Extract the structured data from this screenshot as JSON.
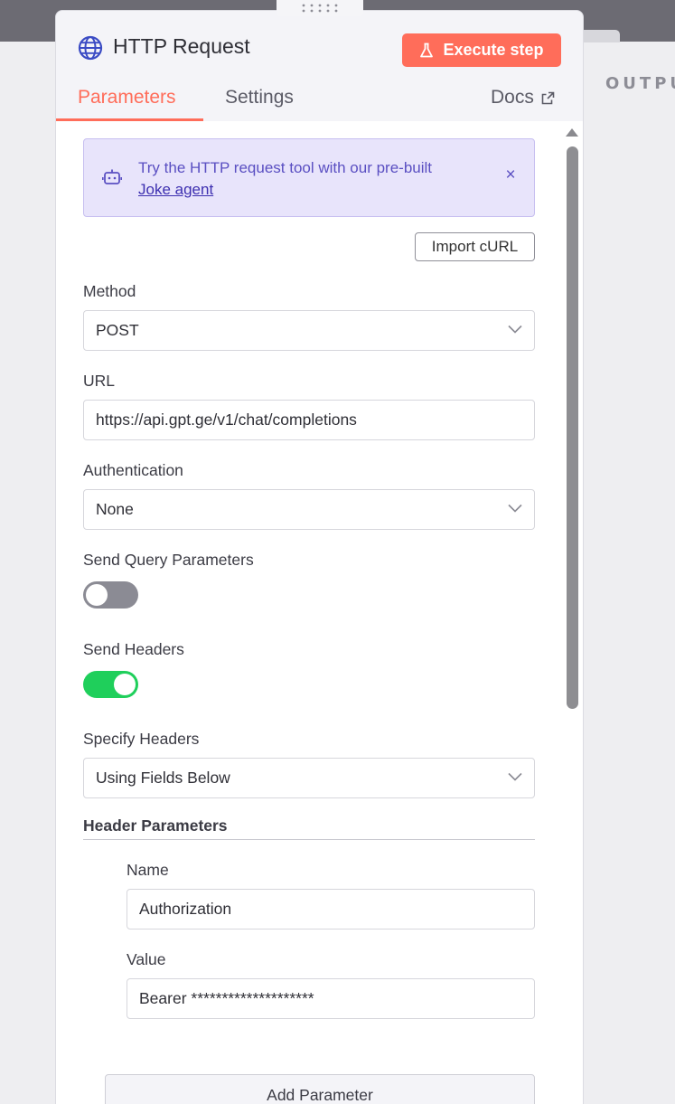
{
  "backdrop": {
    "output_label": "OUTPU"
  },
  "header": {
    "title": "HTTP Request",
    "execute_label": "Execute step",
    "tabs": [
      {
        "label": "Parameters",
        "active": true
      },
      {
        "label": "Settings",
        "active": false
      }
    ],
    "docs_label": "Docs"
  },
  "banner": {
    "text": "Try the HTTP request tool with our pre-built",
    "link_text": "Joke agent",
    "close_glyph": "×"
  },
  "import_curl_label": "Import cURL",
  "fields": {
    "method": {
      "label": "Method",
      "value": "POST"
    },
    "url": {
      "label": "URL",
      "value": "https://api.gpt.ge/v1/chat/completions"
    },
    "authentication": {
      "label": "Authentication",
      "value": "None"
    },
    "send_query": {
      "label": "Send Query Parameters",
      "enabled": false
    },
    "send_headers": {
      "label": "Send Headers",
      "enabled": true
    },
    "specify_headers": {
      "label": "Specify Headers",
      "value": "Using Fields Below"
    }
  },
  "header_parameters": {
    "title": "Header Parameters",
    "name_label": "Name",
    "name_value": "Authorization",
    "value_label": "Value",
    "value_value": "Bearer ********************"
  },
  "add_parameter_label": "Add Parameter",
  "colors": {
    "accent": "#ff6d5a",
    "toggle_on": "#1fcf5b",
    "toggle_off": "#8b8b94",
    "banner_bg": "#e8e4fb",
    "banner_text": "#5a4fc2"
  },
  "icons": {
    "node": "globe-icon",
    "execute": "flask-icon",
    "docs": "external-link-icon",
    "banner": "robot-icon",
    "dropdown": "chevron-down-icon"
  }
}
